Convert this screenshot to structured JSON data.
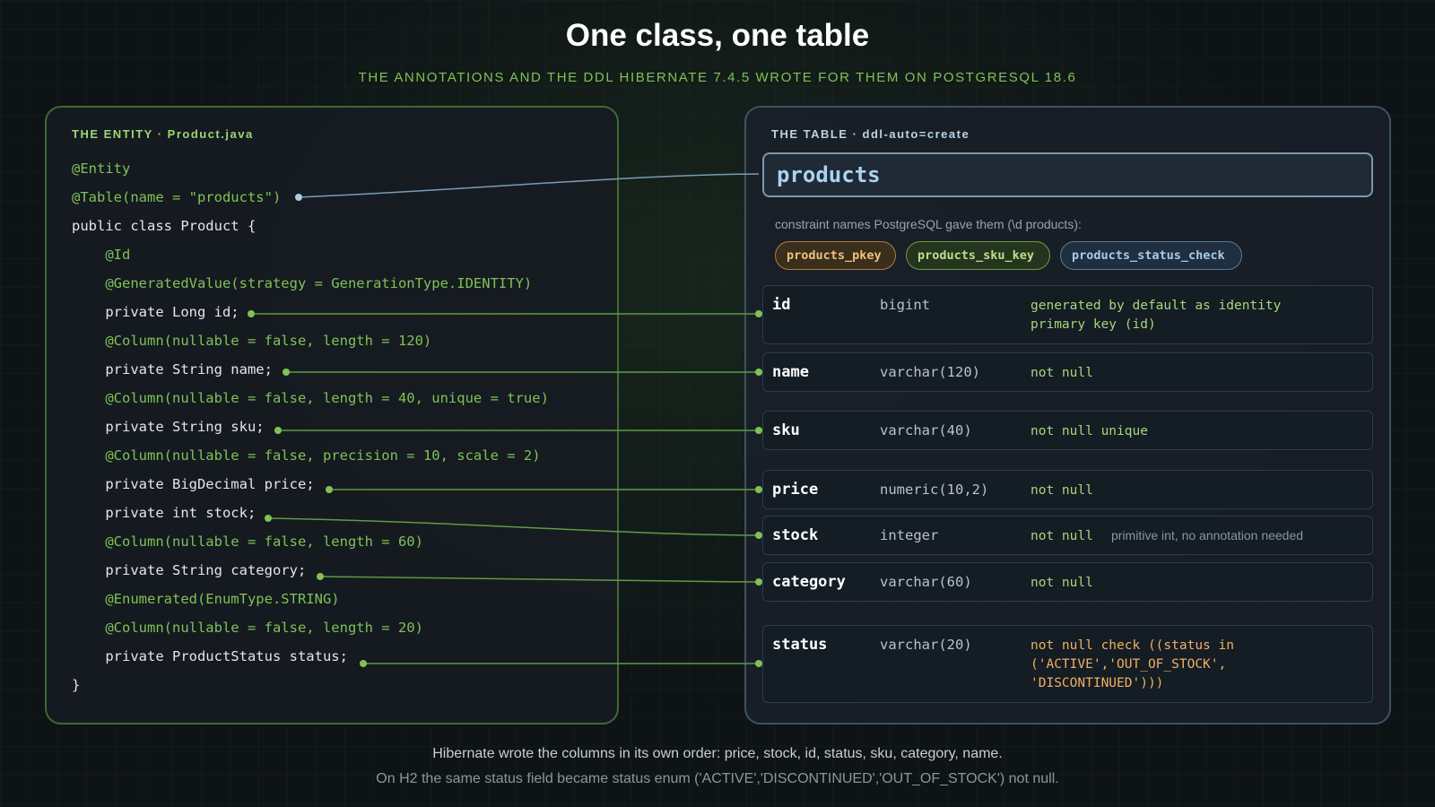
{
  "header": {
    "title": "One class, one table",
    "subtitle": "THE ANNOTATIONS AND THE DDL HIBERNATE 7.4.5 WROTE FOR THEM ON POSTGRESQL 18.6"
  },
  "entity_panel": {
    "label": "THE ENTITY · Product.java",
    "lines": [
      {
        "text": "@Entity",
        "kind": "annotation"
      },
      {
        "text": "@Table(name = \"products\")",
        "kind": "annotation"
      },
      {
        "text": "public class Product {",
        "kind": "code"
      },
      {
        "text": "    @Id",
        "kind": "annotation"
      },
      {
        "text": "    @GeneratedValue(strategy = GenerationType.IDENTITY)",
        "kind": "annotation"
      },
      {
        "text": "    private Long id;",
        "kind": "code"
      },
      {
        "text": "    @Column(nullable = false, length = 120)",
        "kind": "annotation"
      },
      {
        "text": "    private String name;",
        "kind": "code"
      },
      {
        "text": "    @Column(nullable = false, length = 40, unique = true)",
        "kind": "annotation"
      },
      {
        "text": "    private String sku;",
        "kind": "code"
      },
      {
        "text": "    @Column(nullable = false, precision = 10, scale = 2)",
        "kind": "annotation"
      },
      {
        "text": "    private BigDecimal price;",
        "kind": "code"
      },
      {
        "text": "    private int stock;",
        "kind": "code"
      },
      {
        "text": "    @Column(nullable = false, length = 60)",
        "kind": "annotation"
      },
      {
        "text": "    private String category;",
        "kind": "code"
      },
      {
        "text": "    @Enumerated(EnumType.STRING)",
        "kind": "annotation"
      },
      {
        "text": "    @Column(nullable = false, length = 20)",
        "kind": "annotation"
      },
      {
        "text": "    private ProductStatus status;",
        "kind": "code"
      },
      {
        "text": "}",
        "kind": "code"
      }
    ]
  },
  "table_panel": {
    "label": "THE TABLE · ddl-auto=create",
    "table_name": "products",
    "constraint_note": "constraint names PostgreSQL gave them (\\d products):",
    "constraints": [
      "products_pkey",
      "products_sku_key",
      "products_status_check"
    ],
    "columns": [
      {
        "name": "id",
        "type": "bigint",
        "constraint": "generated by default as identity\nprimary key (id)",
        "note": ""
      },
      {
        "name": "name",
        "type": "varchar(120)",
        "constraint": "not null",
        "note": ""
      },
      {
        "name": "sku",
        "type": "varchar(40)",
        "constraint": "not null unique",
        "note": ""
      },
      {
        "name": "price",
        "type": "numeric(10,2)",
        "constraint": "not null",
        "note": ""
      },
      {
        "name": "stock",
        "type": "integer",
        "constraint": "not null",
        "note": "primitive int, no annotation needed"
      },
      {
        "name": "category",
        "type": "varchar(60)",
        "constraint": "not null",
        "note": ""
      },
      {
        "name": "status",
        "type": "varchar(20)",
        "constraint": "not null check ((status in\n('ACTIVE','OUT_OF_STOCK',\n'DISCONTINUED')))",
        "note": ""
      }
    ]
  },
  "footer": {
    "line1": "Hibernate wrote the columns in its own order: price, stock, id, status, sku, category, name.",
    "line2": "On H2 the same status field became status enum ('ACTIVE','DISCONTINUED','OUT_OF_STOCK') not null."
  },
  "colors": {
    "annotation": "#7fc257",
    "link_green": "#5f9a45",
    "link_blue": "#7b9bb5",
    "orange_constraint": "#f0b060"
  }
}
